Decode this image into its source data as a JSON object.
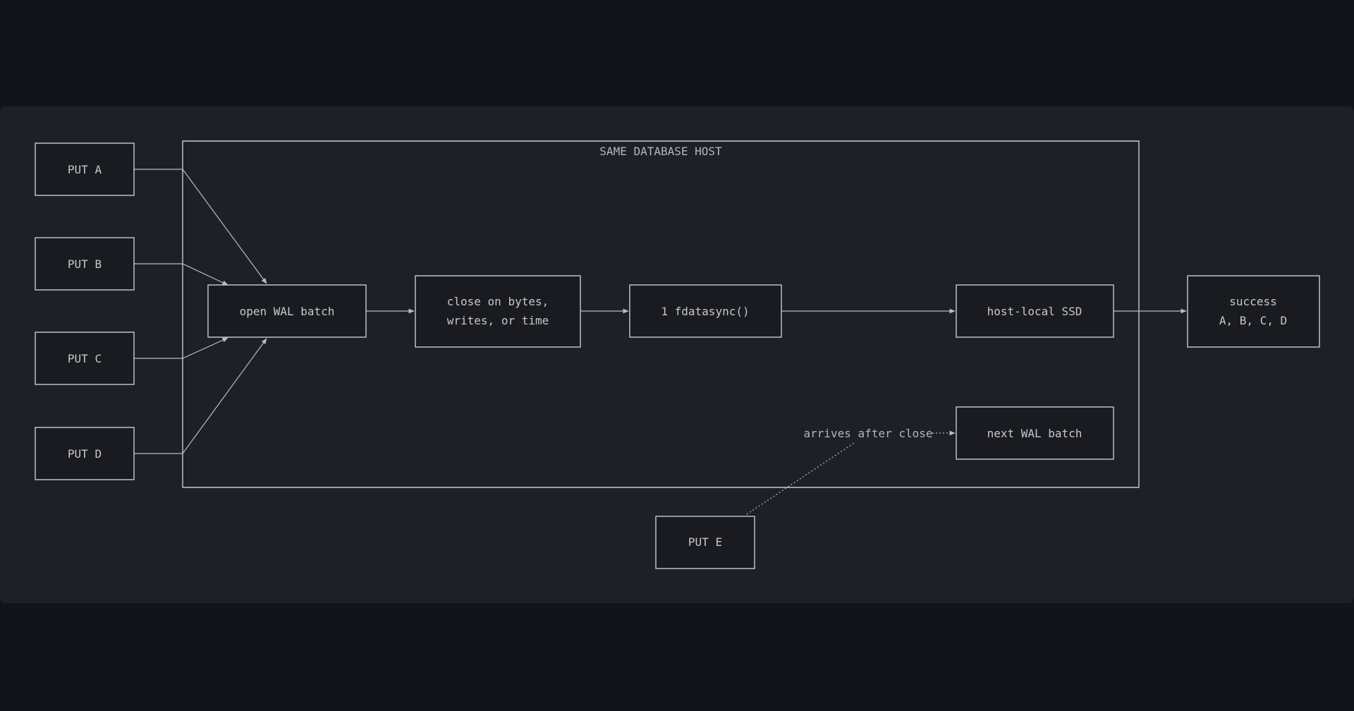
{
  "diagram": {
    "host_label": "SAME DATABASE HOST",
    "nodes": {
      "put_a": "PUT A",
      "put_b": "PUT B",
      "put_c": "PUT C",
      "put_d": "PUT D",
      "open_batch": "open WAL batch",
      "close_batch_line1": "close on bytes,",
      "close_batch_line2": "writes, or time",
      "fdatasync": "1 fdatasync()",
      "ssd": "host-local SSD",
      "success_line1": "success",
      "success_line2": "A, B, C, D",
      "next_batch": "next WAL batch",
      "put_e": "PUT E"
    },
    "edge_labels": {
      "late_arrival": "arrives after close"
    }
  },
  "colors": {
    "page_background": "#11141b",
    "panel_background": "#1e2028",
    "node_fill": "#1a1b20",
    "stroke": "#c8cad0",
    "text": "#c6c8cd"
  }
}
